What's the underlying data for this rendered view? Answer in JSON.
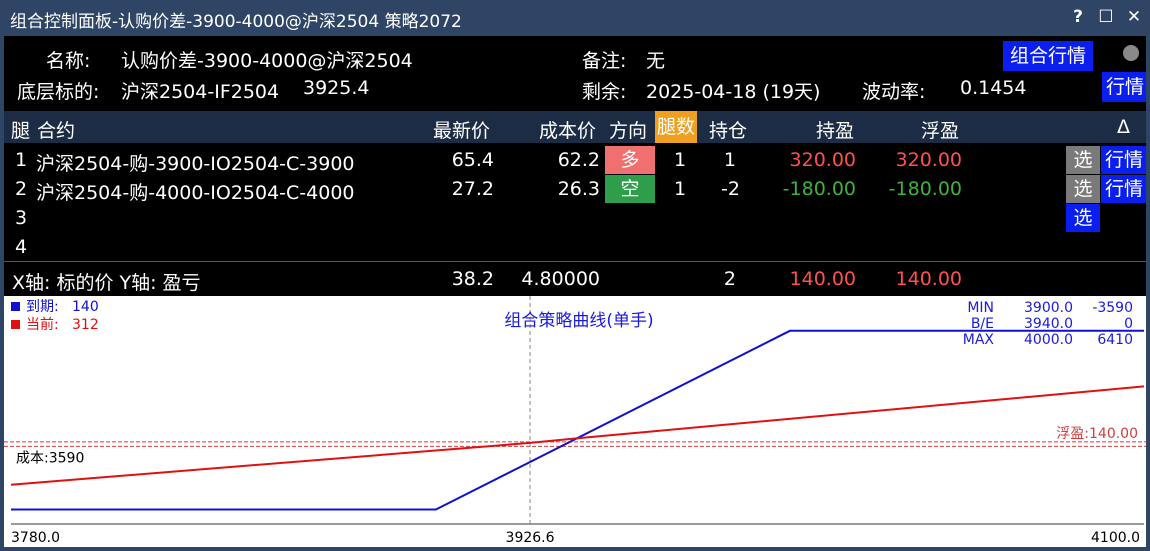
{
  "window": {
    "title": "组合控制面板-认购价差-3900-4000@沪深2504 策略2072",
    "help": "?",
    "maximize": "☐",
    "close": "✕"
  },
  "info": {
    "name_label": "名称:",
    "name_value": "认购价差-3900-4000@沪深2504",
    "note_label": "备注:",
    "note_value": "无",
    "combo_quote_button": "组合行情",
    "underlying_label": "底层标的:",
    "underlying_value": "沪深2504-IF2504",
    "underlying_price": "3925.4",
    "remain_label": "剩余:",
    "remain_value": "2025-04-18 (19天)",
    "vol_label": "波动率:",
    "vol_value": "0.1454",
    "quote_button": "行情"
  },
  "table": {
    "headers": {
      "leg": "腿",
      "contract": "合约",
      "last": "最新价",
      "cost": "成本价",
      "direction": "方向",
      "legs_count": "腿数",
      "position": "持仓",
      "hold_pnl": "持盈",
      "float_pnl": "浮盈",
      "delta": "Δ"
    },
    "rows": [
      {
        "idx": "1",
        "contract": "沪深2504-购-3900-IO2504-C-3900",
        "last": "65.4",
        "cost": "62.2",
        "direction": "多",
        "count": "1",
        "position": "1",
        "hold_pnl": "320.00",
        "float_pnl": "320.00",
        "select": "选",
        "quote": "行情"
      },
      {
        "idx": "2",
        "contract": "沪深2504-购-4000-IO2504-C-4000",
        "last": "27.2",
        "cost": "26.3",
        "direction": "空",
        "count": "1",
        "position": "-2",
        "hold_pnl": "-180.00",
        "float_pnl": "-180.00",
        "select": "选",
        "quote": "行情"
      },
      {
        "idx": "3",
        "select": "选"
      },
      {
        "idx": "4"
      }
    ],
    "summary": {
      "axis_text": "X轴: 标的价   Y轴: 盈亏",
      "last": "38.2",
      "cost": "4.80000",
      "position": "2",
      "hold_pnl": "140.00",
      "float_pnl": "140.00"
    }
  },
  "colors": {
    "titlebar": "#2f4565",
    "header_row": "#1d2c45",
    "accent_blue": "#0a1ef0",
    "long": "#f07070",
    "short": "#2e9e4a",
    "legs_count_bg": "#f0a020",
    "profit": "#ff5050",
    "loss": "#40b040"
  },
  "chart_data": {
    "type": "line",
    "title": "组合策略曲线(单手)",
    "legend": [
      {
        "label": "到期:",
        "value": "140",
        "color": "#1010d0"
      },
      {
        "label": "当前:",
        "value": "312",
        "color": "#e01010"
      }
    ],
    "stats": [
      {
        "label": "MIN",
        "x": "3900.0",
        "y": "-3590"
      },
      {
        "label": "B/E",
        "x": "3940.0",
        "y": "0"
      },
      {
        "label": "MAX",
        "x": "4000.0",
        "y": "6410"
      }
    ],
    "xlim": [
      3780.0,
      4100.0
    ],
    "ylim": [
      -4400,
      7800
    ],
    "x_ticks": [
      "3780.0",
      "3926.6",
      "4100.0"
    ],
    "current_x": 3926.6,
    "cost_line": {
      "label": "成本:3590",
      "y": 0
    },
    "float_line": {
      "label": "浮盈:140.00",
      "y": 140
    },
    "series": [
      {
        "name": "到期",
        "color": "#1010d0",
        "x": [
          3780,
          3900,
          4000,
          4100
        ],
        "y": [
          -3590,
          -3590,
          6410,
          6410
        ]
      },
      {
        "name": "当前",
        "color": "#e01010",
        "x": [
          3780,
          3926.6,
          3940,
          4100
        ],
        "y": [
          -2200,
          140,
          400,
          3300
        ]
      }
    ]
  }
}
